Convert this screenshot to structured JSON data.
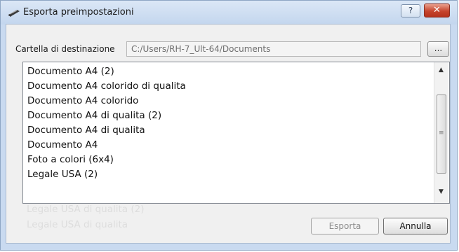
{
  "window": {
    "title": "Esporta preimpostazioni",
    "help_label": "?",
    "close_label": "✕"
  },
  "destination": {
    "label": "Cartella di destinazione",
    "path": "C:/Users/RH-7_Ult-64/Documents",
    "browse_label": "..."
  },
  "presets": [
    "Documento A4 (2)",
    "Documento A4 colorido di qualita",
    "Documento A4 colorido",
    "Documento A4 di qualita (2)",
    "Documento A4 di qualita",
    "Documento A4",
    "Foto a colori (6x4)",
    "Legale USA (2)"
  ],
  "ghost_items": [
    "Legale USA di qualita (2)",
    "Legale USA di qualita"
  ],
  "scrollbar": {
    "up_glyph": "▲",
    "down_glyph": "▼",
    "grip_glyph": "≡"
  },
  "buttons": {
    "export_label": "Esporta",
    "cancel_label": "Annulla"
  }
}
